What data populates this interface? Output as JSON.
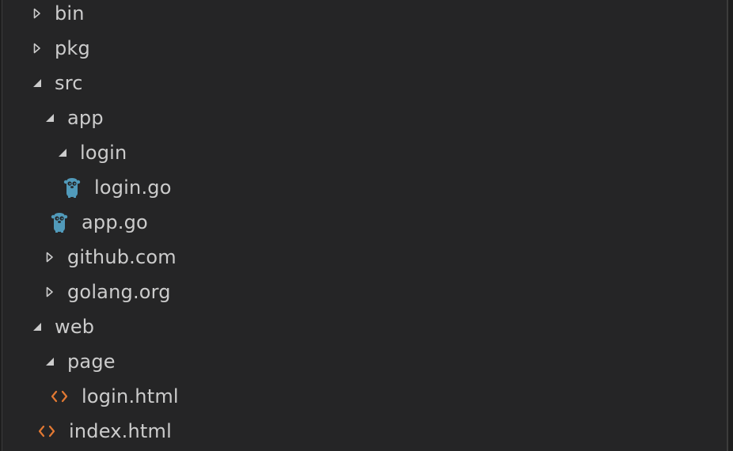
{
  "explorer": {
    "items": [
      {
        "label": "bin",
        "type": "folder",
        "expanded": false
      },
      {
        "label": "pkg",
        "type": "folder",
        "expanded": false
      },
      {
        "label": "src",
        "type": "folder",
        "expanded": true
      },
      {
        "label": "app",
        "type": "folder",
        "expanded": true
      },
      {
        "label": "login",
        "type": "folder",
        "expanded": true
      },
      {
        "label": "login.go",
        "type": "file",
        "icon": "go-gopher-icon"
      },
      {
        "label": "app.go",
        "type": "file",
        "icon": "go-gopher-icon"
      },
      {
        "label": "github.com",
        "type": "folder",
        "expanded": false
      },
      {
        "label": "golang.org",
        "type": "folder",
        "expanded": false
      },
      {
        "label": "web",
        "type": "folder",
        "expanded": true
      },
      {
        "label": "page",
        "type": "folder",
        "expanded": true
      },
      {
        "label": "login.html",
        "type": "file",
        "icon": "html-code-icon"
      },
      {
        "label": "index.html",
        "type": "file",
        "icon": "html-code-icon"
      }
    ]
  },
  "colors": {
    "background": "#252526",
    "text": "#cccccc",
    "twistie": "#cccccc",
    "go_icon": "#519aba",
    "html_icon": "#e37933"
  }
}
